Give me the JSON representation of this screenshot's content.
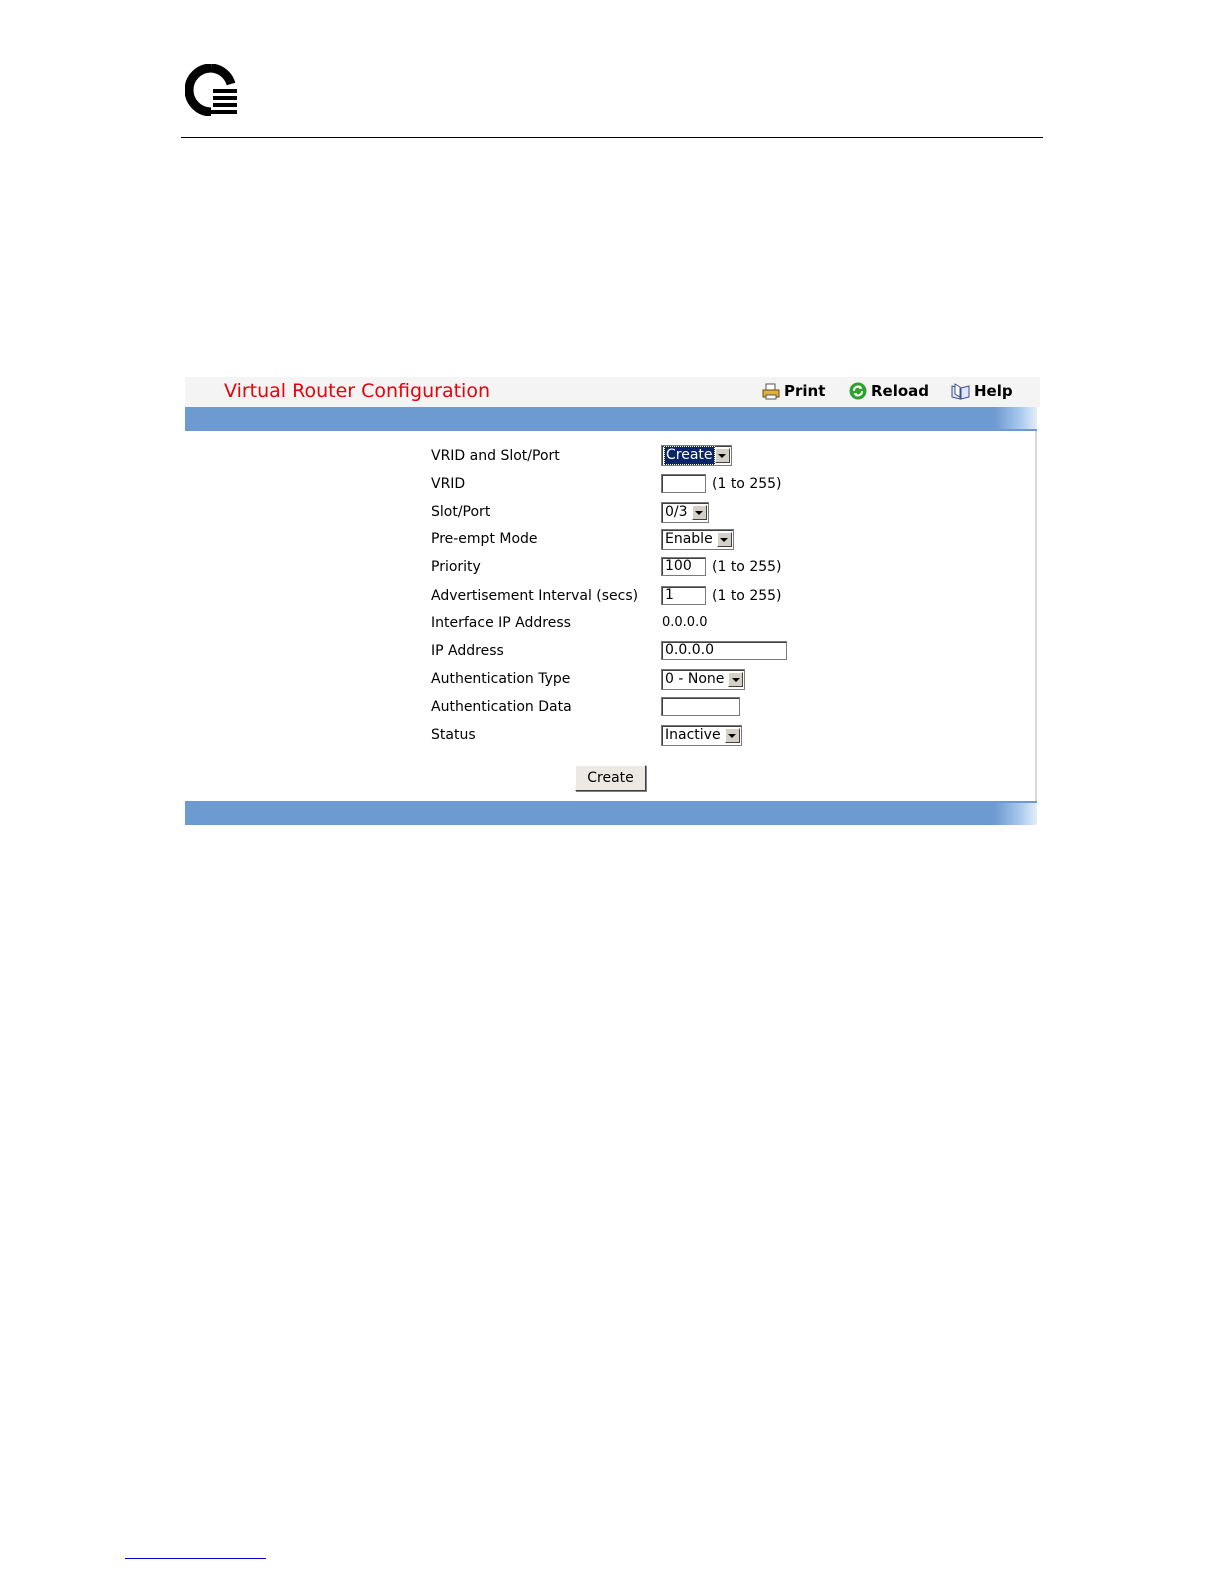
{
  "title": "Virtual Router Configuration",
  "toolbar": {
    "print": "Print",
    "reload": "Reload",
    "help": "Help"
  },
  "fields": {
    "vrid_slot": {
      "label": "VRID and Slot/Port",
      "value": "Create"
    },
    "vrid": {
      "label": "VRID",
      "value": "",
      "range": "(1 to 255)"
    },
    "slot_port": {
      "label": "Slot/Port",
      "value": "0/3"
    },
    "preempt": {
      "label": "Pre-empt Mode",
      "value": "Enable"
    },
    "priority": {
      "label": "Priority",
      "value": "100",
      "range": "(1 to 255)"
    },
    "adv_interval": {
      "label": "Advertisement Interval (secs)",
      "value": "1",
      "range": "(1 to 255)"
    },
    "iface_ip": {
      "label": "Interface IP Address",
      "value": "0.0.0.0"
    },
    "ip_address": {
      "label": "IP Address",
      "value": "0.0.0.0"
    },
    "auth_type": {
      "label": "Authentication Type",
      "value": "0 - None"
    },
    "auth_data": {
      "label": "Authentication Data",
      "value": ""
    },
    "status": {
      "label": "Status",
      "value": "Inactive"
    }
  },
  "submit_label": "Create",
  "colors": {
    "title": "#e8000a",
    "band": "#6d9ad1",
    "selection": "#0a246a"
  }
}
